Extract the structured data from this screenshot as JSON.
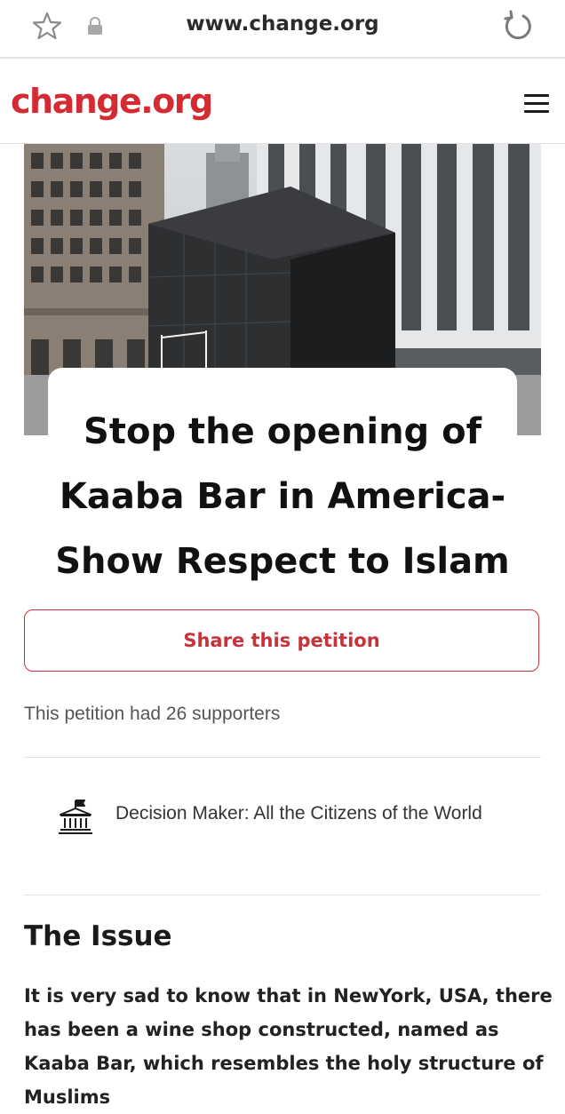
{
  "browser": {
    "url": "www.change.org"
  },
  "header": {
    "logo": "change.org"
  },
  "petition": {
    "title": "Stop the opening of Kaaba Bar in America- Show Respect to Islam",
    "share_label": "Share this petition",
    "supporters_text": "This petition had 26 supporters",
    "decision_maker": "Decision Maker: All the Citizens of the World"
  },
  "issue": {
    "heading": "The Issue",
    "body": "It is very sad to know that in NewYork, USA, there has been a wine shop constructed, named as Kaaba Bar, which resembles the holy structure of Muslims"
  },
  "colors": {
    "brand_red": "#d42b32",
    "button_border": "#c8323a"
  },
  "icons": [
    "star-icon",
    "lock-icon",
    "reload-icon",
    "menu-icon",
    "government-building-icon"
  ]
}
